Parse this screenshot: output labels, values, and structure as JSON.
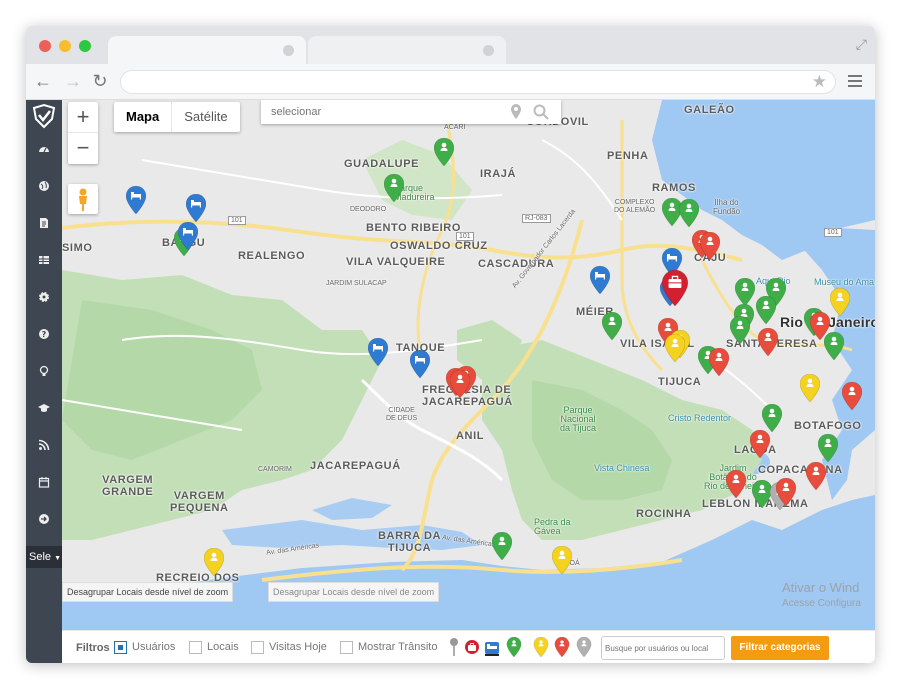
{
  "browser": {
    "url": "",
    "colors": {
      "close": "#ef5f57",
      "minimize": "#f6bd2f",
      "maximize": "#2bc840"
    }
  },
  "sidebar": {
    "icons": [
      "dashboard-icon",
      "globe-icon",
      "document-icon",
      "table-icon",
      "settings-icon",
      "help-icon",
      "lightbulb-icon",
      "graduation-cap-icon",
      "rss-icon",
      "calendar-icon",
      "sign-out-icon"
    ],
    "select_label": "Sele"
  },
  "map": {
    "zoom_in": "+",
    "zoom_out": "−",
    "maptype": {
      "map": "Mapa",
      "satellite": "Satélite"
    },
    "search_placeholder": "selecionar",
    "places": {
      "galeao": "GALEÃO",
      "guadalupe": "GUADALUPE",
      "iraja": "IRAJÁ",
      "penha": "PENHA",
      "ramos": "RAMOS",
      "cordovil": "CORDOVIL",
      "acari": "ACARI",
      "parque_madureira": "Parque\nMadureira",
      "deodoro": "DEODORO",
      "bento_ribeiro": "BENTO RIBEIRO",
      "oswaldo_cruz": "OSWALDO CRUZ",
      "complexo_alemao": "COMPLEXO\nDO ALEMÃO",
      "ilha_fundao": "Ilha do\nFundão",
      "simo": "SIMO",
      "bangu": "BANGU",
      "realengo": "REALENGO",
      "vila_valqueire": "VILA VALQUEIRE",
      "cascadura": "CASCADURA",
      "caju": "CAJU",
      "aquario": "AquaRio",
      "museu": "Museu do Ama",
      "jardim_sulacap": "JARDIM SULACAP",
      "meier": "MÉIER",
      "rio": "Rio de Janeiro",
      "tanque": "TANQUE",
      "vila_isabel": "VILA ISABEL",
      "santa_teresa": "SANTA TERESA",
      "tijuca": "TIJUCA",
      "freguesia": "FREGUESIA DE\nJACAREPAGUÁ",
      "cidade_deus": "CIDADE\nDE DEUS",
      "cristo": "Cristo Redentor",
      "botafogo": "BOTAFOGO",
      "anil": "ANIL",
      "parque_tijuca": "Parque\nNacional\nda Tijuca",
      "lagoa": "LAGOA",
      "vista_chinesa": "Vista Chinesa",
      "jardim_botanico": "Jardim\nBotânico do\nRio de Janeiro",
      "copacabana": "COPACABANA",
      "camorim": "CAMORIM",
      "jacarepagua": "JACAREPAGUÁ",
      "vargem_grande": "VARGEM\nGRANDE",
      "vargem_pequena": "VARGEM\nPEQUENA",
      "rocinha": "ROCINHA",
      "leblon": "LEBLON IPANEMA",
      "pedra_gavea": "Pedra da\nGávea",
      "barra": "BARRA DA\nTIJUCA",
      "recreio": "RECREIO DOS",
      "joa": "JOÁ",
      "av_americas": "Av. das Américas",
      "av_americas2": "Av. das Américas",
      "r101a": "101",
      "r101b": "101",
      "r101c": "101",
      "rj083": "RJ-083",
      "av_gov": "Av. Governador Carlos Lacerda",
      "watermark1": "Ativar o Wind",
      "watermark2": "Acesse Configura"
    },
    "tooltips": [
      "Desagrupar Locais desde nível de zoom",
      "Desagrupar Locais desde nível de zoom"
    ]
  },
  "filters": {
    "label": "Filtros",
    "usuarios": "Usuários",
    "locais": "Locais",
    "visitas_hoje": "Visitas Hoje",
    "mostrar_transito": "Mostrar Trânsito",
    "search_placeholder": "Busque por usuários ou local",
    "button": "Filtrar categorias",
    "usuarios_checked": true,
    "locais_checked": false,
    "visitas_checked": false,
    "transito_checked": false
  },
  "legend_colors": {
    "green": "#3fae49",
    "red": "#e74c3c",
    "yellow": "#f4d21f",
    "blue": "#2f7bd1",
    "gray": "#b0b0b0",
    "case": "#d32030"
  }
}
